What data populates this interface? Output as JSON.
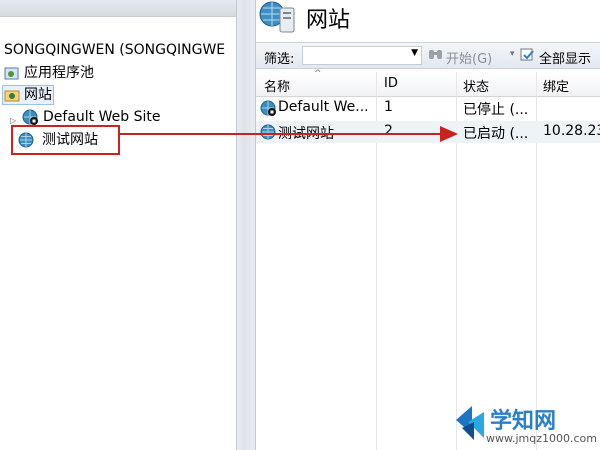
{
  "tree": {
    "server": "SONGQINGWEN (SONGQINGWE",
    "app_pools": "应用程序池",
    "sites": "网站",
    "default_site": "Default Web Site",
    "test_site": "测试网站"
  },
  "main": {
    "title": "网站",
    "filter_label": "筛选:",
    "start_button": "开始(G)",
    "show_all_button": "全部显示",
    "columns": [
      "名称",
      "ID",
      "状态",
      "绑定"
    ],
    "rows": [
      {
        "name": "Default We...",
        "id": "1",
        "status": "已停止 (...",
        "binding": ""
      },
      {
        "name": "测试网站",
        "id": "2",
        "status": "已启动 (...",
        "binding": "10.28.23"
      }
    ]
  },
  "watermark": {
    "brand": "学知网",
    "url": "www.jmqz1000.com"
  },
  "colors": {
    "annotation_red": "#c8231e",
    "selection_blue": "#cfe3f7"
  }
}
